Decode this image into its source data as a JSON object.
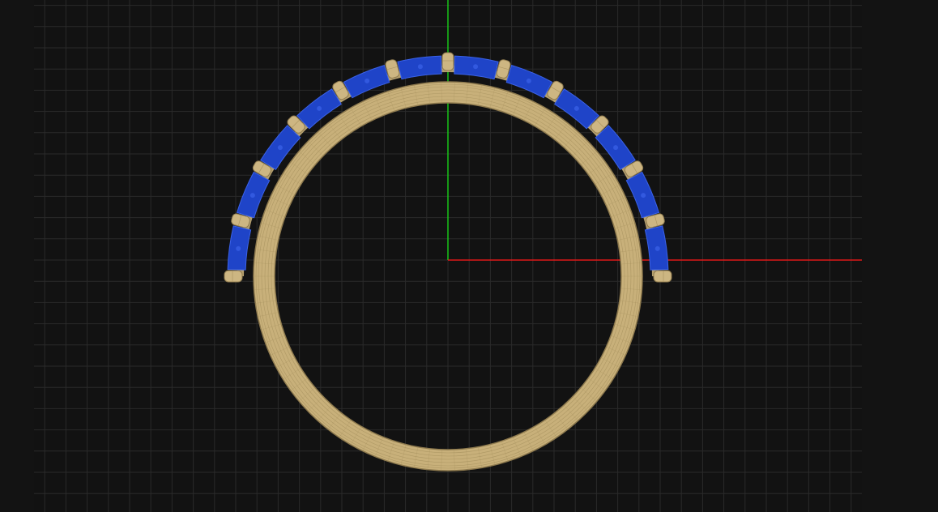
{
  "viewport": {
    "background_color": "#121212",
    "grid_color": "#2a2a2a",
    "x_axis_color": "#e01818",
    "y_axis_color": "#18c418"
  },
  "model": {
    "name": "eternity-ring",
    "band_color": "#c8b07a",
    "band_shadow_color": "#8e7a4e",
    "wire_color": "#a8925f",
    "stone_color": "#1f44c8",
    "stone_highlight_color": "#3a62e8",
    "prong_color": "#cdb682",
    "stone_count": 12,
    "prong_count": 13
  }
}
